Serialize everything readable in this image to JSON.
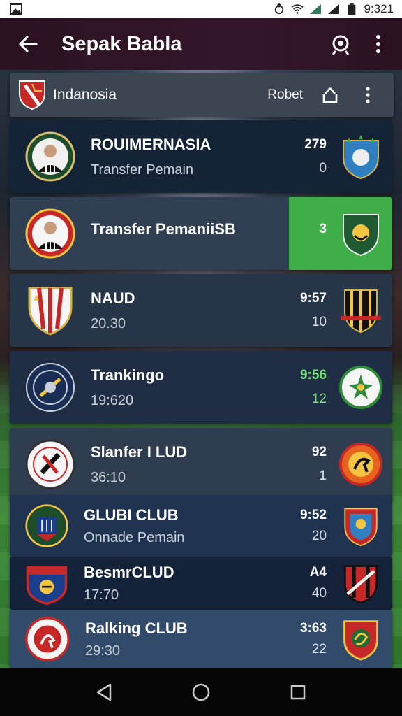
{
  "status_bar": {
    "time": "9:321"
  },
  "app_bar": {
    "title": "Sepak Babla",
    "icons": [
      "back-arrow-icon",
      "camera-icon",
      "more-vert-icon"
    ]
  },
  "sub_header": {
    "title": "Indanosia",
    "action": "Robet",
    "icons": [
      "share-icon",
      "more-vert-icon"
    ]
  },
  "colors": {
    "app_bar": "#34162a",
    "card": "#263548",
    "highlight": "#3fae49"
  },
  "rows": [
    {
      "name": "ROUIMERNASIA",
      "sub": "Transfer Pemain",
      "n1": "279",
      "n2": "0"
    },
    {
      "name": "Transfer PemaniiSB",
      "sub": "",
      "n1": "3",
      "n2": ""
    },
    {
      "name": "NAUD",
      "sub": "20.30",
      "n1": "9:57",
      "n2": "10"
    },
    {
      "name": "Trankingo",
      "sub": "19:620",
      "n1": "9:56",
      "n2": "12"
    },
    {
      "name": "Slanfer I LUD",
      "sub": "36:10",
      "n1": "92",
      "n2": "1"
    },
    {
      "name": "GLUBI CLUB",
      "sub": "Onnade Pemain",
      "n1": "9:52",
      "n2": "20"
    },
    {
      "name": "BesmrCLUD",
      "sub": "17:70",
      "n1": "A4",
      "n2": "40"
    },
    {
      "name": "Ralking CLUB",
      "sub": "29:30",
      "n1": "3:63",
      "n2": "22"
    }
  ]
}
